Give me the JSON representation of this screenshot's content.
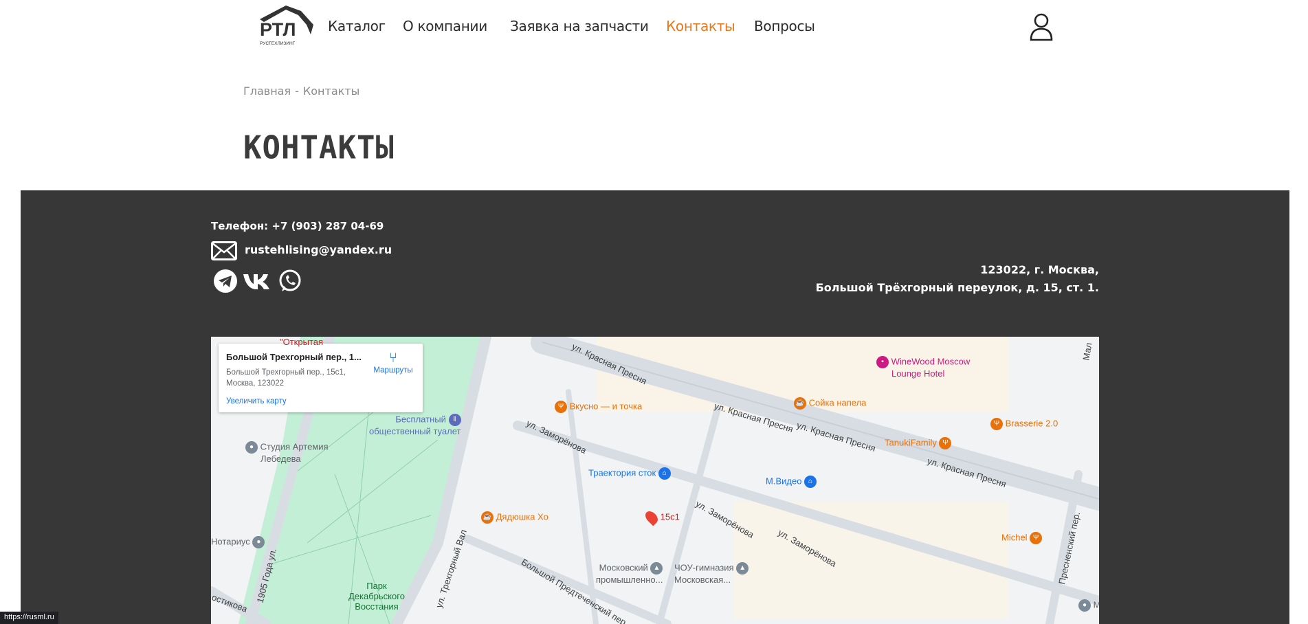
{
  "logo": {
    "text": "РТЛ",
    "subtitle": "РУСТЕХЛИЗИНГ"
  },
  "nav": [
    {
      "label": "Каталог"
    },
    {
      "label": "О компании"
    },
    {
      "label": "Заявка на запчасти"
    },
    {
      "label": "Контакты",
      "active": true
    },
    {
      "label": "Вопросы"
    }
  ],
  "breadcrumb": {
    "home": "Главная",
    "sep": "-",
    "current": "Контакты"
  },
  "page_title": "КОНТАКТЫ",
  "contacts": {
    "phone": "Телефон: +7 (903) 287 04-69",
    "email": "rustehlising@yandex.ru",
    "address_line1": "123022, г. Москва,",
    "address_line2": "Большой Трёхгорный переулок, д. 15, ст. 1.",
    "socials": [
      "telegram",
      "vk",
      "whatsapp"
    ]
  },
  "map": {
    "card": {
      "title": "Большой Трехгорный пер., 1...",
      "address": "Большой Трехгорный пер., 15с1, Москва, 123022",
      "zoom_link": "Увеличить карту",
      "directions": "Маршруты"
    },
    "marker": "15с1",
    "places": {
      "otkrytaya": "\"Открытая",
      "winewood": "WineWood Moscow",
      "winewood2": "Lounge Hotel",
      "soyka": "Сойка напела",
      "vkusno": "Вкусно — и точка",
      "toilet1": "Бесплатный",
      "toilet2": "общественный туалет",
      "studio1": "Студия Артемия",
      "studio2": "Лебедева",
      "brasserie": "Brasserie 2.0",
      "tanuki": "TanukiFamily",
      "traektoriya": "Траектория сток",
      "mvideo": "М.Видео",
      "dyadyushka": "Дядюшка Хо",
      "michel": "Michel",
      "notarius": "Нотариус",
      "mosprom1": "Московский",
      "mosprom2": "промышленно...",
      "gym1": "ЧОУ-гимназия",
      "gym2": "Московская...",
      "park1": "Парк",
      "park2": "Декабрьского",
      "park3": "Восстания",
      "mc": "МС"
    },
    "streets": {
      "kp1": "ул. Красная Пресня",
      "kp2": "ул. Красная Пресня",
      "kp3": "ул. Красная Пресня",
      "kp4": "ул. Красная Пресня",
      "zam1": "ул. Заморёнова",
      "zam2": "ул. Заморёнова",
      "zam3": "ул. Заморёнова",
      "y1905": "1905 Года ул.",
      "tval": "ул. Трехгорный Вал",
      "predt": "Большой Предтеченский пер.",
      "presn": "Пресненский пер.",
      "ostik": "остикова",
      "mal": "Мал"
    }
  },
  "status_url": "https://rusml.ru"
}
